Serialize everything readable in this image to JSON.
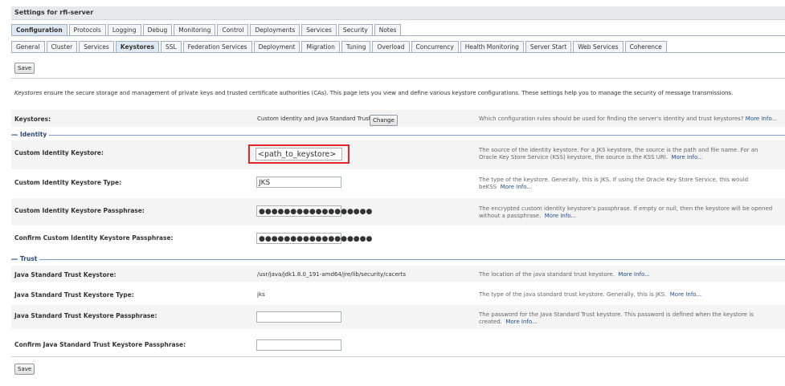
{
  "page": {
    "title": "Settings for rfi-server"
  },
  "tabs_primary": [
    {
      "label": "Configuration",
      "active": true
    },
    {
      "label": "Protocols"
    },
    {
      "label": "Logging"
    },
    {
      "label": "Debug"
    },
    {
      "label": "Monitoring"
    },
    {
      "label": "Control"
    },
    {
      "label": "Deployments"
    },
    {
      "label": "Services"
    },
    {
      "label": "Security"
    },
    {
      "label": "Notes"
    }
  ],
  "tabs_secondary": [
    {
      "label": "General"
    },
    {
      "label": "Cluster"
    },
    {
      "label": "Services"
    },
    {
      "label": "Keystores",
      "active": true
    },
    {
      "label": "SSL"
    },
    {
      "label": "Federation Services"
    },
    {
      "label": "Deployment"
    },
    {
      "label": "Migration"
    },
    {
      "label": "Tuning"
    },
    {
      "label": "Overload"
    },
    {
      "label": "Concurrency"
    },
    {
      "label": "Health Monitoring"
    },
    {
      "label": "Server Start"
    },
    {
      "label": "Web Services"
    },
    {
      "label": "Coherence"
    }
  ],
  "buttons": {
    "save_top": "Save",
    "save_bottom": "Save",
    "change": "Change"
  },
  "intro": {
    "italic": "Keystores",
    "text": " ensure the secure storage and management of private keys and trusted certificate authorities (CAs). This page lets you view and define various keystore configurations. These settings help you to manage the security of message transmissions."
  },
  "keystores": {
    "label": "Keystores:",
    "value": "Custom Identity and Java Standard Trust",
    "help": "Which configuration rules should be used for finding the server's identity and trust keystores?",
    "more": "More Info..."
  },
  "sections": {
    "identity": "Identity",
    "trust": "Trust"
  },
  "identity": {
    "keystore_label": "Custom Identity Keystore:",
    "keystore_value": "<path_to_keystore>",
    "keystore_help1": "The source of the identity keystore. For a JKS keystore, the source is the path and file name. For an",
    "keystore_help2": "Oracle Key Store Service (KSS) keystore, the source is the KSS URI.",
    "keystore_more": "More Info...",
    "type_label": "Custom Identity Keystore Type:",
    "type_value": "JKS",
    "type_help1": "The type of the keystore. Generally, this is JKS. If using the Oracle Key Store Service, this would",
    "type_help2": "beKSS",
    "type_more": "More Info...",
    "pass_label": "Custom Identity Keystore Passphrase:",
    "pass_value": "●●●●●●●●●●●●●●●●●●",
    "pass_help1": "The encrypted custom identity keystore's passphrase. If empty or null, then the keystore will be opened",
    "pass_help2": "without a passphrase.",
    "pass_more": "More Info...",
    "confirm_label": "Confirm Custom Identity Keystore Passphrase:",
    "confirm_value": "●●●●●●●●●●●●●●●●●●"
  },
  "trust": {
    "keystore_label": "Java Standard Trust Keystore:",
    "keystore_value": "/usr/java/jdk1.8.0_191-amd64/jre/lib/security/cacerts",
    "keystore_help": "The location of the java standard trust keystore.",
    "keystore_more": "More Info...",
    "type_label": "Java Standard Trust Keystore Type:",
    "type_value": "jks",
    "type_help": "The type of the java standard trust keystore. Generally, this is JKS.",
    "type_more": "More Info...",
    "pass_label": "Java Standard Trust Keystore Passphrase:",
    "pass_help1": "The password for the Java Standard Trust keystore. This password is defined when the keystore is",
    "pass_help2": "created.",
    "pass_more": "More Info...",
    "confirm_label": "Confirm Java Standard Trust Keystore Passphrase:"
  },
  "colors": {
    "highlight": "#e0262d",
    "link": "#1e4b8f",
    "section": "#2a4a7a"
  }
}
